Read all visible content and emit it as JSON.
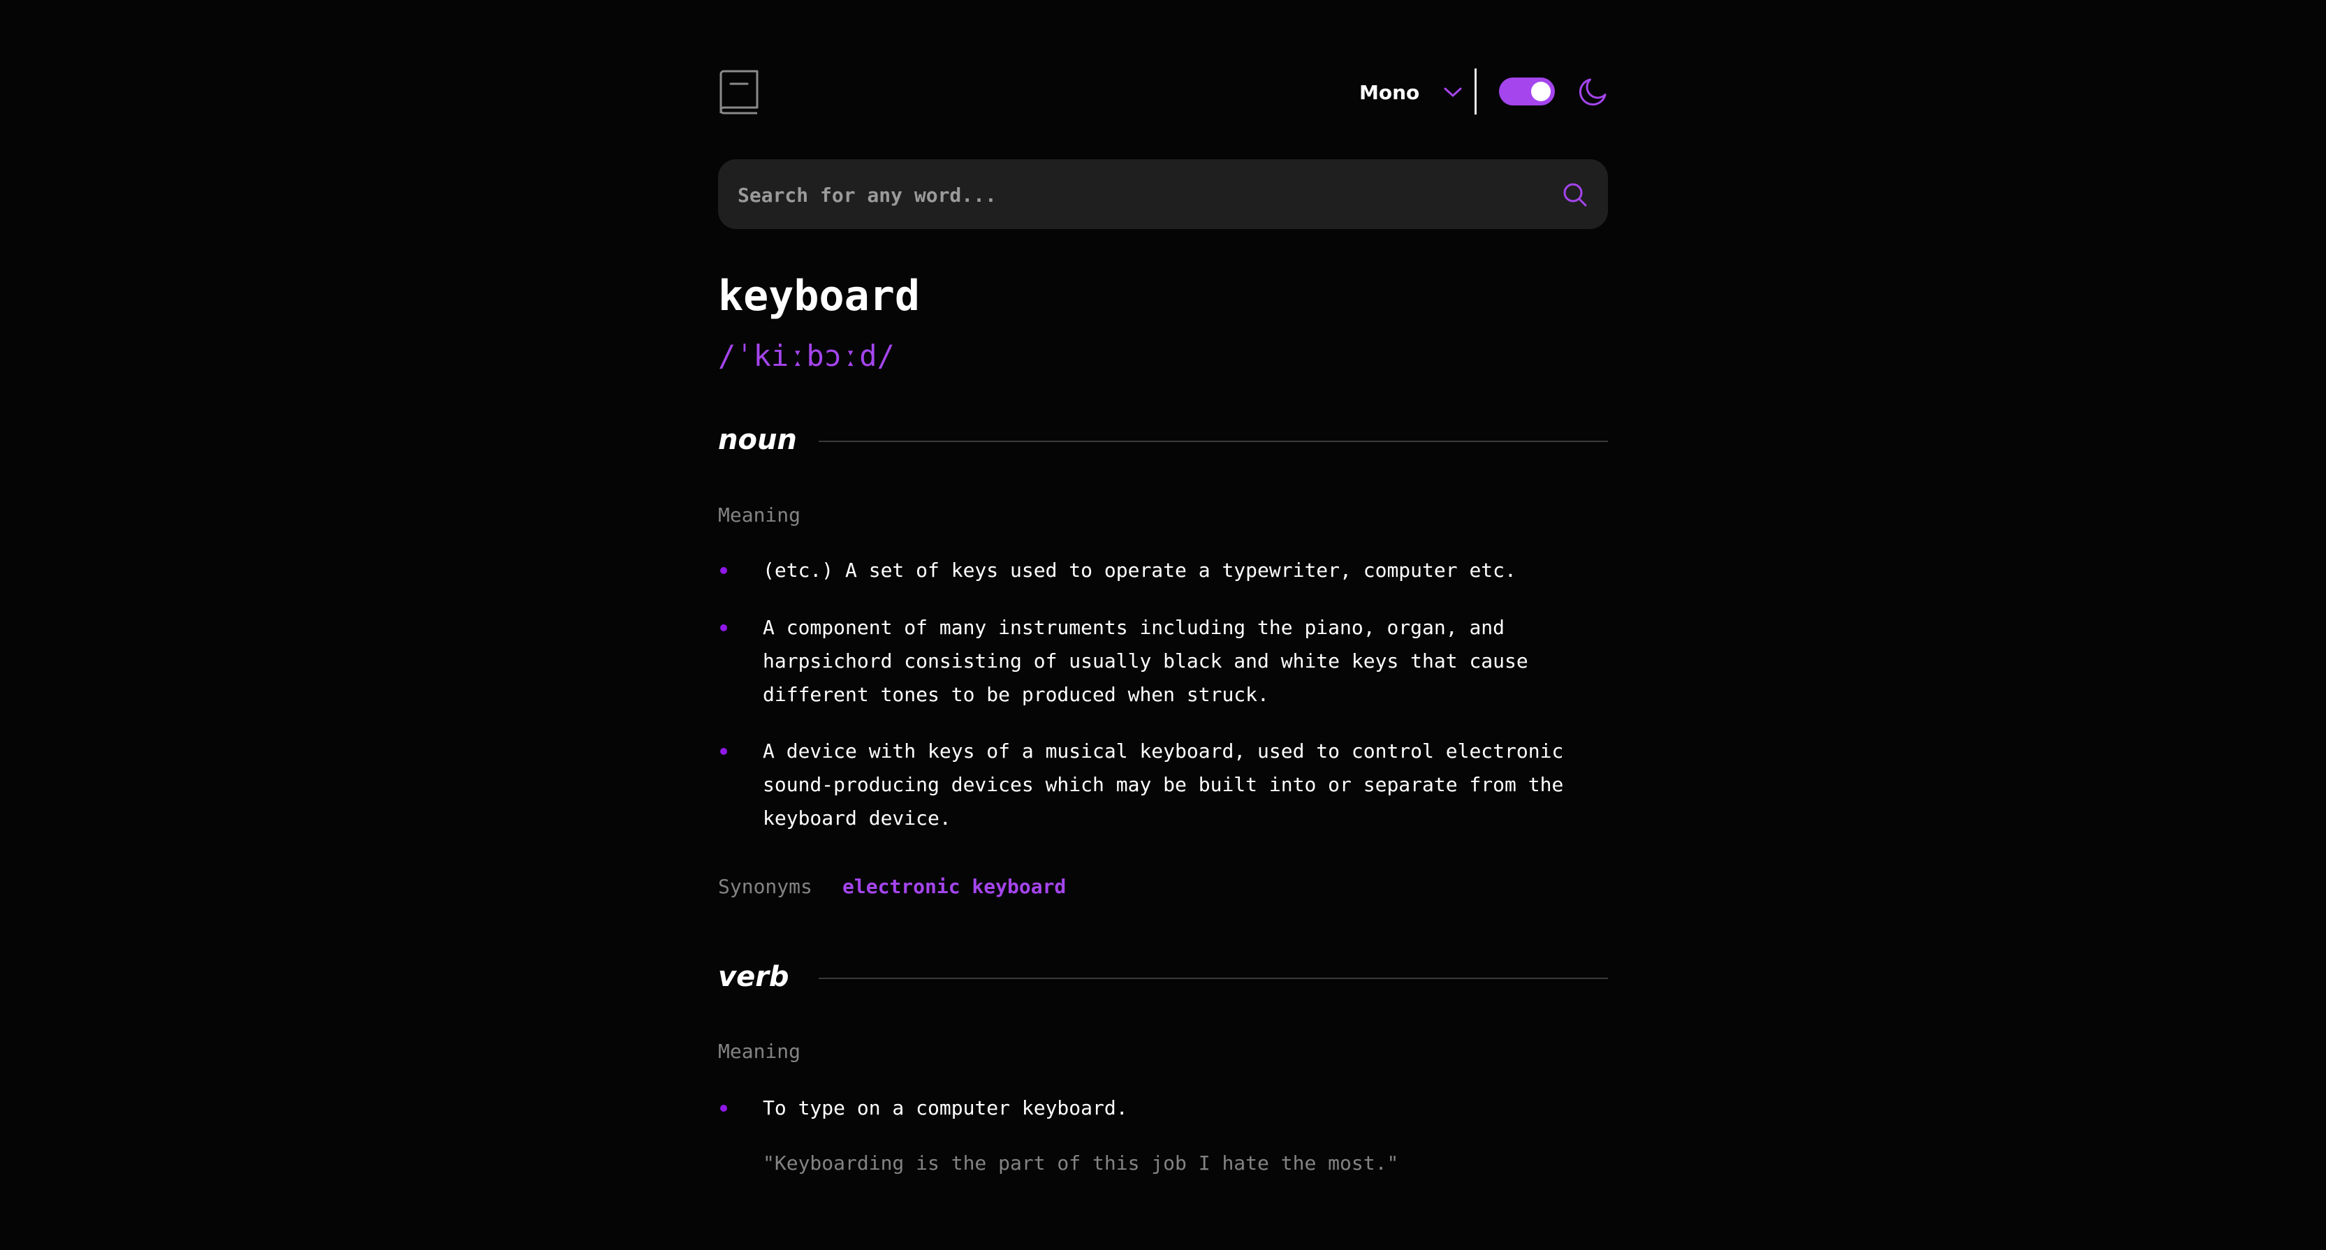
{
  "header": {
    "font_selected": "Mono",
    "theme_toggle_on": true,
    "logo_icon": "book-icon",
    "chevron_icon": "chevron-down-icon",
    "moon_icon": "moon-icon"
  },
  "search": {
    "placeholder": "Search for any word...",
    "value": "",
    "icon": "search-icon"
  },
  "entry": {
    "word": "keyboard",
    "phonetic": "/ˈkiːbɔːd/"
  },
  "noun": {
    "part_of_speech": "noun",
    "meaning_label": "Meaning",
    "definitions": [
      "(etc.) A set of keys used to operate a typewriter, computer etc.",
      "A component of many instruments including the piano, organ, and harpsichord consisting of usually black and white keys that cause different tones to be produced when struck.",
      "A device with keys of a musical keyboard, used to control electronic sound-producing devices which may be built into or separate from the keyboard device."
    ],
    "synonyms_label": "Synonyms",
    "synonym": "electronic keyboard"
  },
  "verb": {
    "part_of_speech": "verb",
    "meaning_label": "Meaning",
    "definition": "To type on a computer keyboard.",
    "example": "\"Keyboarding is the part of this job I hate the most.\""
  },
  "colors": {
    "background": "#050505",
    "accent": "#a445ed",
    "search_bg": "#1f1f1f",
    "muted_text": "#838383"
  }
}
